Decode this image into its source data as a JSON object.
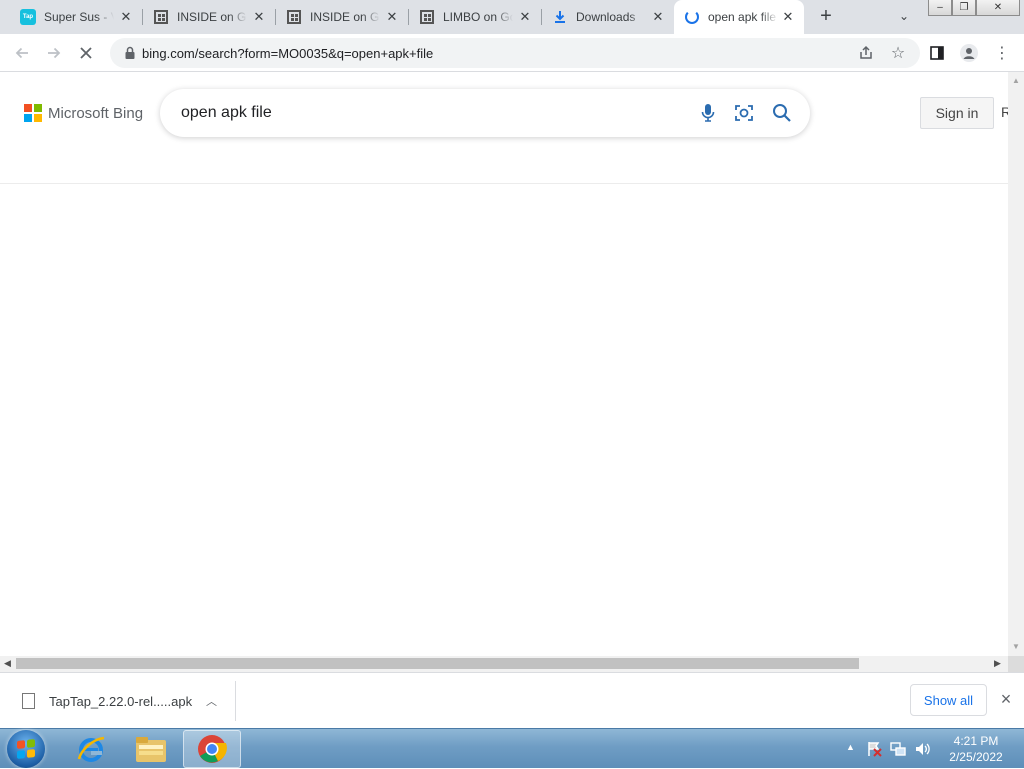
{
  "tabs": [
    {
      "title": "Super Sus - V",
      "favicon": "taptap-icon"
    },
    {
      "title": "INSIDE on Go",
      "favicon": "qr-icon"
    },
    {
      "title": "INSIDE on Go",
      "favicon": "qr-icon"
    },
    {
      "title": "LIMBO on Go",
      "favicon": "qr-icon"
    },
    {
      "title": "Downloads",
      "favicon": "download-icon"
    },
    {
      "title": "open apk file",
      "favicon": "loading-spinner-icon"
    }
  ],
  "favicon_text": {
    "taptap": "Tap"
  },
  "omnibox": {
    "url": "bing.com/search?form=MO0035&q=open+apk+file"
  },
  "bing": {
    "brand": "Microsoft Bing",
    "query": "open apk file",
    "signin": "Sign in",
    "cutoff": "R"
  },
  "download": {
    "filename": "TapTap_2.22.0-rel.....apk"
  },
  "shelf": {
    "show_all": "Show all"
  },
  "taskbar": {
    "time": "4:21 PM",
    "date": "2/25/2022"
  },
  "colors": {
    "accent": "#1a73e8",
    "bing_icon": "#2b6cb0"
  }
}
